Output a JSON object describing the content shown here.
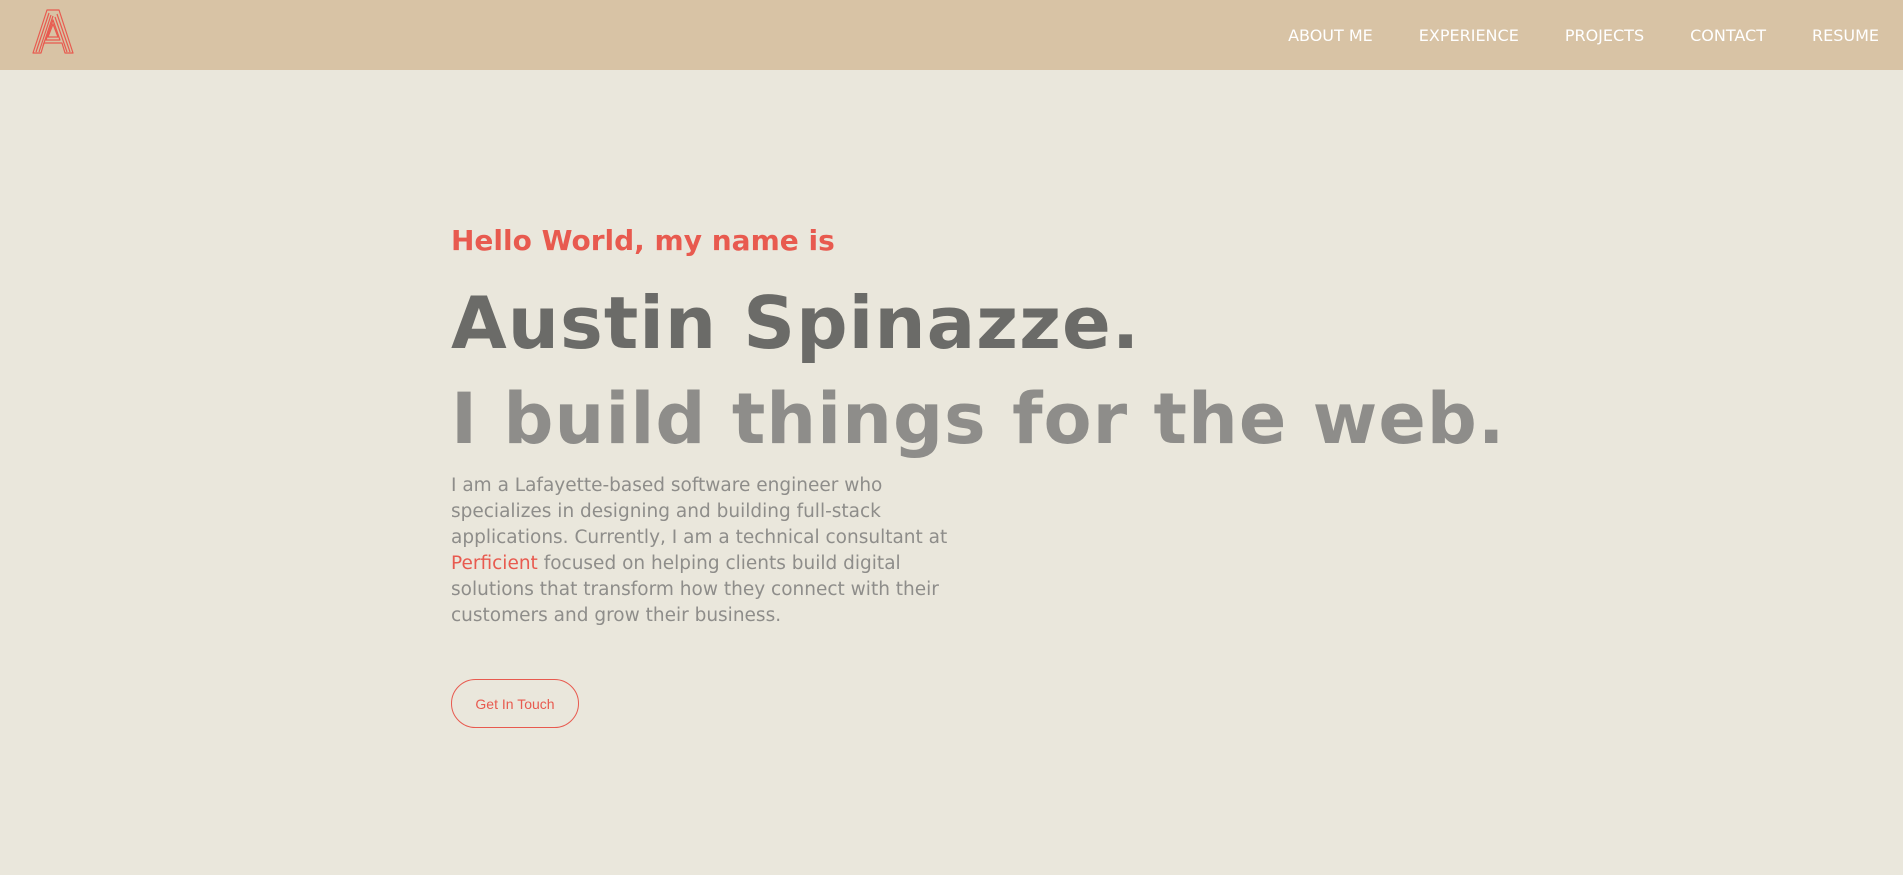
{
  "navbar": {
    "logo_icon": "striped-letter-a-logo",
    "links": [
      {
        "label": "ABOUT ME"
      },
      {
        "label": "EXPERIENCE"
      },
      {
        "label": "PROJECTS"
      },
      {
        "label": "CONTACT"
      },
      {
        "label": "RESUME"
      }
    ]
  },
  "hero": {
    "greeting": "Hello World, my name is",
    "name": "Austin Spinazze.",
    "tagline": "I build things for the web.",
    "bio": {
      "before": "I am a Lafayette-based software engineer who specializes in designing and building full-stack applications. Currently, I am a technical consultant at ",
      "company": "Perficient",
      "after": " focused on helping clients build digital solutions that transform how they connect with their customers and grow their business."
    },
    "cta_label": "Get In Touch"
  },
  "colors": {
    "navbar_bg": "#D8C3A5",
    "page_bg": "#EAE7DC",
    "accent": "#E85A4F",
    "name_text": "#6B6B68",
    "muted_text": "#8E8D8A",
    "nav_text": "#FFFFFF"
  }
}
